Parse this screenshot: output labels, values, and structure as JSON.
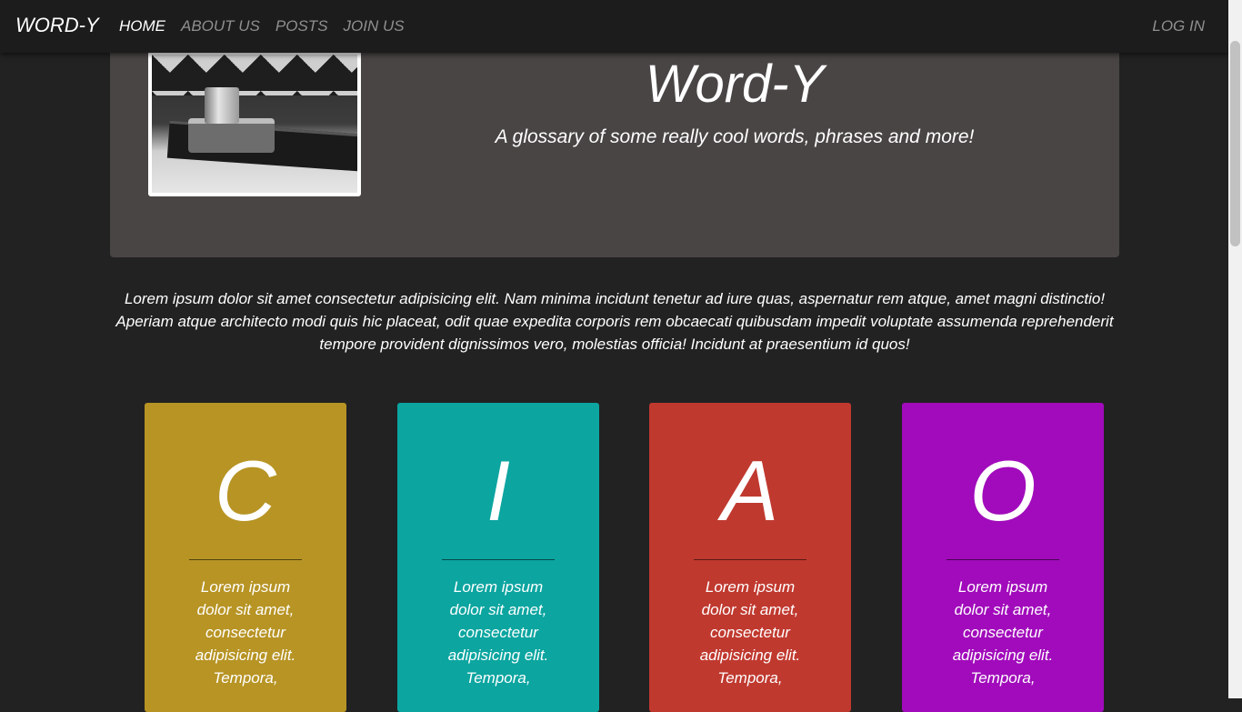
{
  "navbar": {
    "brand": "WORD-Y",
    "links": [
      "HOME",
      "ABOUT US",
      "POSTS",
      "JOIN US"
    ],
    "login": "LOG IN"
  },
  "hero": {
    "title": "Word-Y",
    "subtitle": "A glossary of some really cool words, phrases and more!",
    "image_icon": "camera-photo"
  },
  "intro": "Lorem ipsum dolor sit amet consectetur adipisicing elit. Nam minima incidunt tenetur ad iure quas, aspernatur rem atque, amet magni distinctio! Aperiam atque architecto modi quis hic placeat, odit quae expedita corporis rem obcaecati quibusdam impedit voluptate assumenda reprehenderit tempore provident dignissimos vero, molestias officia! Incidunt at praesentium id quos!",
  "cards": [
    {
      "letter": "C",
      "color": "#b79424",
      "text": "Lorem ipsum dolor sit amet, consectetur adipisicing elit. Tempora,"
    },
    {
      "letter": "I",
      "color": "#0ca5a0",
      "text": "Lorem ipsum dolor sit amet, consectetur adipisicing elit. Tempora,"
    },
    {
      "letter": "A",
      "color": "#c0392f",
      "text": "Lorem ipsum dolor sit amet, consectetur adipisicing elit. Tempora,"
    },
    {
      "letter": "O",
      "color": "#a10bbb",
      "text": "Lorem ipsum dolor sit amet, consectetur adipisicing elit. Tempora,"
    }
  ],
  "colors": {
    "page_bg": "#222222",
    "navbar_bg": "#1c1c1c",
    "hero_bg": "#4a4545"
  }
}
